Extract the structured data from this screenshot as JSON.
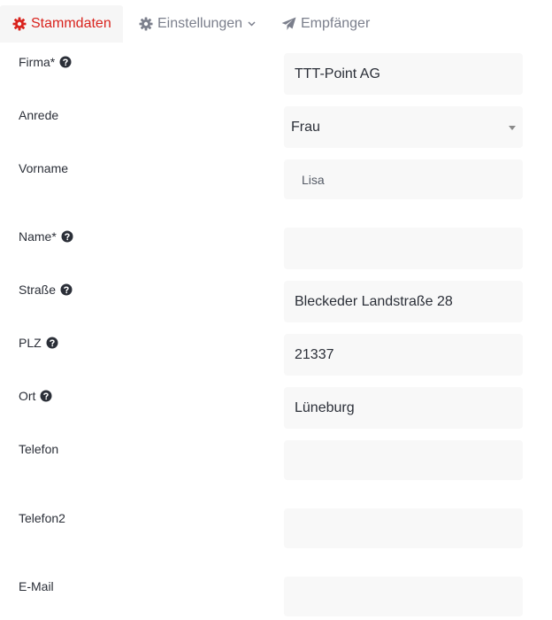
{
  "tabs": {
    "stammdaten": "Stammdaten",
    "einstellungen": "Einstellungen",
    "empfaenger": "Empfänger"
  },
  "form": {
    "firma": {
      "label": "Firma*",
      "value": "TTT-Point AG"
    },
    "anrede": {
      "label": "Anrede",
      "value": "Frau"
    },
    "vorname": {
      "label": "Vorname",
      "value": "Lisa"
    },
    "name": {
      "label": "Name*",
      "value": ""
    },
    "strasse": {
      "label": "Straße",
      "value": "Bleckeder Landstraße 28"
    },
    "plz": {
      "label": "PLZ",
      "value": "21337"
    },
    "ort": {
      "label": "Ort",
      "value": "Lüneburg"
    },
    "telefon": {
      "label": "Telefon",
      "value": ""
    },
    "telefon2": {
      "label": "Telefon2",
      "value": ""
    },
    "email": {
      "label": "E-Mail",
      "value": ""
    }
  },
  "colors": {
    "accent": "#d9231d",
    "tab_inactive": "#7b7f8c",
    "field_bg": "#f8f8f8"
  },
  "icons": {
    "stammdaten": "gear-icon",
    "einstellungen": "gear-icon",
    "empfaenger": "paper-plane-icon",
    "help": "question-circle-icon",
    "dropdown": "chevron-down-icon"
  }
}
